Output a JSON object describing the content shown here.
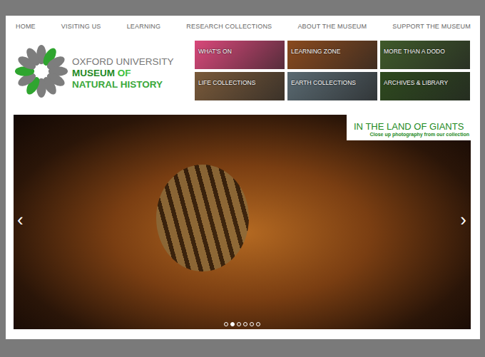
{
  "nav": [
    {
      "label": "HOME"
    },
    {
      "label": "VISITING US"
    },
    {
      "label": "LEARNING"
    },
    {
      "label": "RESEARCH COLLECTIONS"
    },
    {
      "label": "ABOUT THE MUSEUM"
    },
    {
      "label": "SUPPORT THE MUSEUM"
    }
  ],
  "logo": {
    "line1": "OXFORD UNIVERSITY",
    "line2a": "MUSEUM",
    "line2b": "OF",
    "line3": "NATURAL HISTORY"
  },
  "tiles": [
    {
      "label": "WHAT'S ON",
      "color": "#d9487a"
    },
    {
      "label": "LEARNING ZONE",
      "color": "#8a4a1e"
    },
    {
      "label": "MORE THAN A DODO",
      "color": "#3f5a2a"
    },
    {
      "label": "LIFE COLLECTIONS",
      "color": "#7a5a3a"
    },
    {
      "label": "EARTH COLLECTIONS",
      "color": "#5a6a72"
    },
    {
      "label": "ARCHIVES & LIBRARY",
      "color": "#2e4a1e"
    }
  ],
  "hero": {
    "title": "IN THE LAND OF GIANTS",
    "subtitle": "Close up photography from our collection",
    "prev": "‹",
    "next": "›",
    "dots": [
      {
        "selected": false
      },
      {
        "selected": true
      },
      {
        "selected": false
      },
      {
        "selected": false
      },
      {
        "selected": false
      },
      {
        "selected": false
      }
    ]
  }
}
